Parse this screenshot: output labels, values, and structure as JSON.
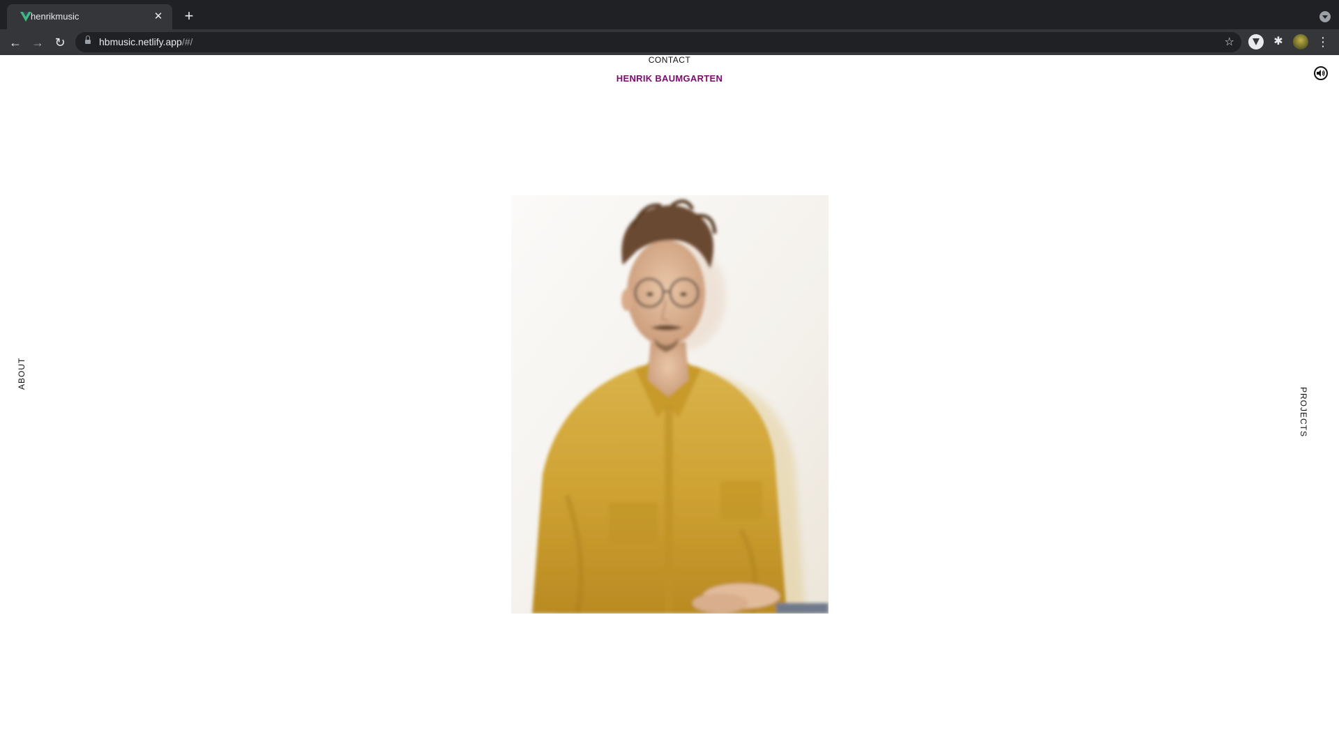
{
  "browser": {
    "tab_title": "henrikmusic",
    "tab_close": "✕",
    "new_tab": "+",
    "url_host": "hbmusic.netlify.app",
    "url_path": "/#/",
    "back": "←",
    "forward": "→",
    "reload": "↻",
    "star": "☆",
    "puzzle": "✱",
    "menu": "⋮"
  },
  "site": {
    "title": "HENRIK BAUMGARTEN",
    "nav_about": "ABOUT",
    "nav_projects": "PROJECTS",
    "nav_contact": "CONTACT",
    "title_color": "#7a0c6e"
  },
  "icons": {
    "favicon": "vue-v-icon",
    "sound": "speaker-icon",
    "lock": "lock-icon",
    "star": "star-icon"
  }
}
